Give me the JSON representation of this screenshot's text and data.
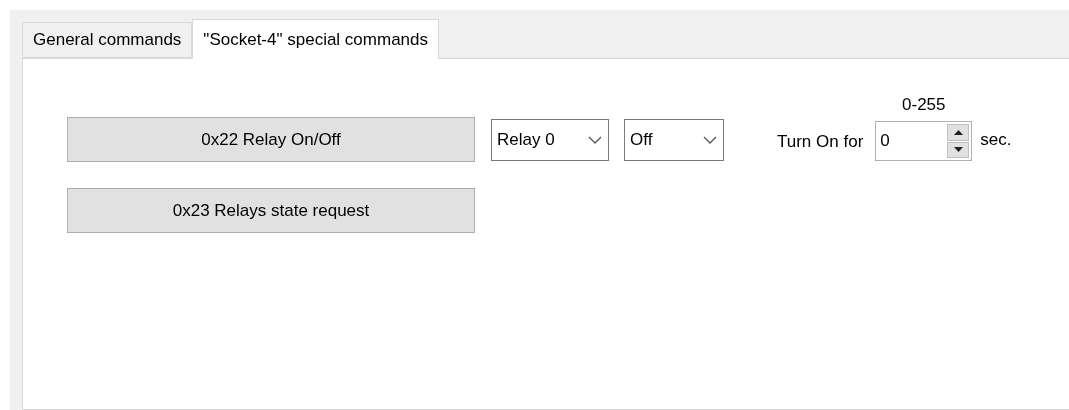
{
  "tabs": [
    {
      "label": "General commands",
      "selected": false
    },
    {
      "label": "\"Socket-4\" special commands",
      "selected": true
    }
  ],
  "relay_command": {
    "button": "0x22 Relay On/Off",
    "relay_select": {
      "value": "Relay 0"
    },
    "state_select": {
      "value": "Off"
    },
    "duration": {
      "label": "Turn On for",
      "range_hint": "0-255",
      "value": "0",
      "unit": "sec."
    }
  },
  "state_request": {
    "button": "0x23 Relays state request"
  }
}
